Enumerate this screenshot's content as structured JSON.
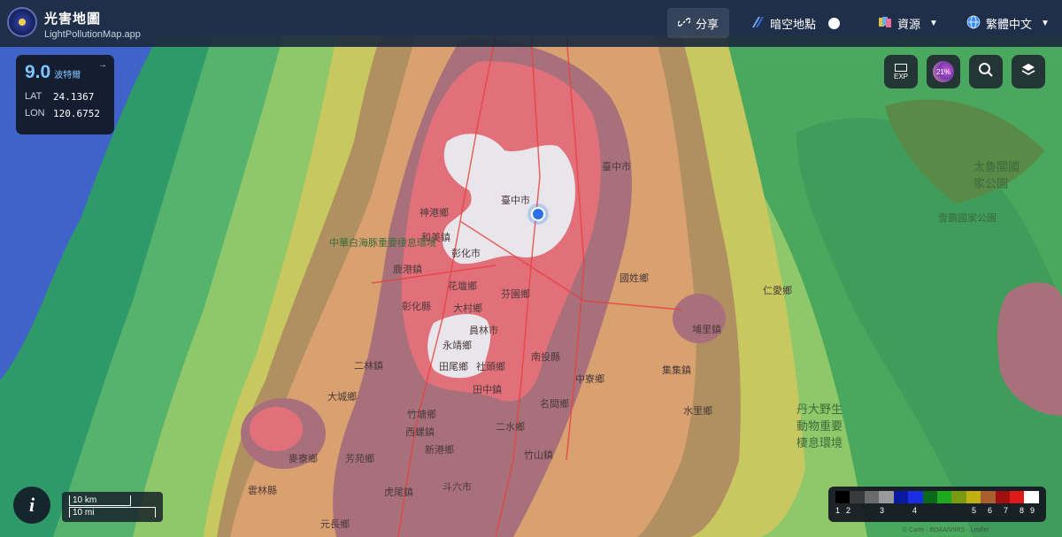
{
  "app": {
    "title": "光害地圖",
    "subtitle": "LightPollutionMap.app"
  },
  "topbar": {
    "share_label": "分享",
    "dark_sites_label": "暗空地點",
    "resources_label": "資源",
    "language_label": "繁體中文"
  },
  "info_panel": {
    "bortle_value": "9.0",
    "bortle_unit": "波特爾",
    "lat_label": "LAT",
    "lat_value": "24.1367",
    "lon_label": "LON",
    "lon_value": "120.6752"
  },
  "right_buttons": {
    "exp_label": "EXP",
    "overlay_label": "21%"
  },
  "scale": {
    "km_label": "10 km",
    "mi_label": "10 mi"
  },
  "legend": {
    "colors": [
      "#000000",
      "#3a3a3a",
      "#6b6b6b",
      "#9a9a9a",
      "#0a1aa0",
      "#1a2ee6",
      "#0a6a1a",
      "#1eaa1e",
      "#7a9a10",
      "#c0b010",
      "#a86030",
      "#a01010",
      "#e01a1a",
      "#ffffff"
    ],
    "labels": [
      "1",
      "2",
      "3",
      "4",
      "5",
      "6",
      "7",
      "8",
      "9"
    ]
  },
  "map_labels": [
    {
      "text": "臺中市",
      "cls": ""
    },
    {
      "text": "臺中市",
      "cls": ""
    },
    {
      "text": "神港鄉",
      "cls": ""
    },
    {
      "text": "和美鎮",
      "cls": ""
    },
    {
      "text": "彰化市",
      "cls": ""
    },
    {
      "text": "鹿港鎮",
      "cls": ""
    },
    {
      "text": "花壇鄉",
      "cls": ""
    },
    {
      "text": "芬園鄉",
      "cls": ""
    },
    {
      "text": "彰化縣",
      "cls": ""
    },
    {
      "text": "大村鄉",
      "cls": ""
    },
    {
      "text": "員林市",
      "cls": ""
    },
    {
      "text": "永靖鄉",
      "cls": ""
    },
    {
      "text": "田尾鄉",
      "cls": ""
    },
    {
      "text": "社頭鄉",
      "cls": ""
    },
    {
      "text": "田中鎮",
      "cls": ""
    },
    {
      "text": "南投縣",
      "cls": ""
    },
    {
      "text": "二林鎮",
      "cls": ""
    },
    {
      "text": "竹塘鄉",
      "cls": ""
    },
    {
      "text": "二水鄉",
      "cls": ""
    },
    {
      "text": "名間鄉",
      "cls": ""
    },
    {
      "text": "集集鎮",
      "cls": ""
    },
    {
      "text": "中寮鄉",
      "cls": ""
    },
    {
      "text": "國姓鄉",
      "cls": ""
    },
    {
      "text": "埔里鎮",
      "cls": ""
    },
    {
      "text": "仁愛鄉",
      "cls": ""
    },
    {
      "text": "水里鄉",
      "cls": ""
    },
    {
      "text": "西螺鎮",
      "cls": ""
    },
    {
      "text": "新港鄉",
      "cls": ""
    },
    {
      "text": "斗六市",
      "cls": ""
    },
    {
      "text": "竹山鎮",
      "cls": ""
    },
    {
      "text": "麥寮鄉",
      "cls": ""
    },
    {
      "text": "大城鄉",
      "cls": ""
    },
    {
      "text": "芳苑鄉",
      "cls": ""
    },
    {
      "text": "丹大野生動物重要棲息環境",
      "cls": "green big"
    },
    {
      "text": "太魯閣國家公園",
      "cls": "green big"
    },
    {
      "text": "雪霸國家公園",
      "cls": "green"
    },
    {
      "text": "中華白海豚重要棲息環境",
      "cls": "green"
    },
    {
      "text": "雲林縣",
      "cls": ""
    },
    {
      "text": "元長鄉",
      "cls": ""
    },
    {
      "text": "虎尾鎮",
      "cls": ""
    }
  ],
  "attribution": "© Carto · BOAA/VIIRS · Leaflet"
}
